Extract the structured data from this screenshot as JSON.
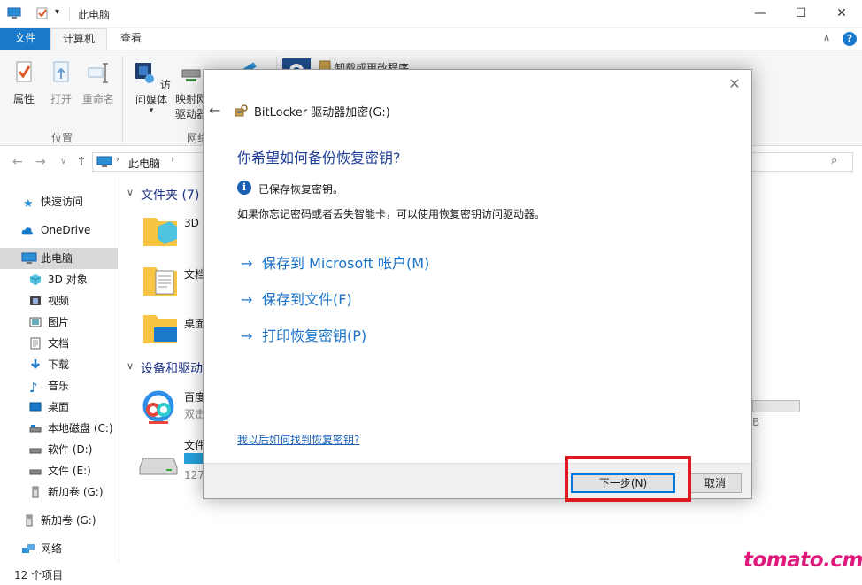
{
  "window": {
    "title": "此电脑",
    "controls": {
      "minimize": "—",
      "maximize": "☐",
      "close": "✕"
    }
  },
  "ribbon_tabs": [
    "文件",
    "计算机",
    "查看"
  ],
  "ribbon": {
    "location_group": {
      "label": "位置",
      "buttons": [
        "属性",
        "打开",
        "重命名"
      ]
    },
    "network_group": {
      "label": "网络",
      "access_media": "访问媒体",
      "map_drive_line1": "映射网",
      "map_drive_line2": "驱动器"
    },
    "uninstall_label": "卸载或更改程序"
  },
  "address": {
    "root": "此电脑"
  },
  "nav": {
    "items": [
      {
        "label": "快速访问",
        "icon": "star-icon"
      },
      {
        "label": "OneDrive",
        "icon": "cloud-icon"
      },
      {
        "label": "此电脑",
        "icon": "computer-icon"
      },
      {
        "label": "3D 对象",
        "icon": "cube-icon"
      },
      {
        "label": "视频",
        "icon": "film-icon"
      },
      {
        "label": "图片",
        "icon": "picture-icon"
      },
      {
        "label": "文档",
        "icon": "document-icon"
      },
      {
        "label": "下载",
        "icon": "download-icon"
      },
      {
        "label": "音乐",
        "icon": "music-icon"
      },
      {
        "label": "桌面",
        "icon": "desktop-icon"
      },
      {
        "label": "本地磁盘 (C:)",
        "icon": "drive-icon"
      },
      {
        "label": "软件 (D:)",
        "icon": "drive-icon"
      },
      {
        "label": "文件 (E:)",
        "icon": "drive-icon"
      },
      {
        "label": "新加卷 (G:)",
        "icon": "usb-drive-icon"
      },
      {
        "label": "新加卷 (G:)",
        "icon": "usb-drive-icon"
      },
      {
        "label": "网络",
        "icon": "network-icon"
      }
    ]
  },
  "content": {
    "folders_header": "文件夹 (7)",
    "folders": [
      "3D",
      "文档",
      "桌面"
    ],
    "devices_header": "设备和驱动",
    "devices": [
      {
        "name": "百度",
        "sub": "双击"
      },
      {
        "name": "文件",
        "sub": "127"
      }
    ],
    "partial_b": "B"
  },
  "status": {
    "count": "12 个项目"
  },
  "dialog": {
    "close": "✕",
    "back": "←",
    "title": "BitLocker 驱动器加密(G:)",
    "heading": "你希望如何备份恢复密钥?",
    "info_glyph": "i",
    "saved_text": "已保存恢复密钥。",
    "description": "如果你忘记密码或者丢失智能卡，可以使用恢复密钥访问驱动器。",
    "options": [
      "保存到 Microsoft 帐户(M)",
      "保存到文件(F)",
      "打印恢复密钥(P)"
    ],
    "help_link": "我以后如何找到恢复密钥?",
    "next_button": "下一步(N)",
    "cancel_button": "取消"
  },
  "watermark": "tomato.cm",
  "colors": {
    "accent": "#1979ca",
    "link": "#1a73c8",
    "heading": "#1e3c96",
    "highlight": "#e0181f",
    "watermark": "#e0197d"
  }
}
